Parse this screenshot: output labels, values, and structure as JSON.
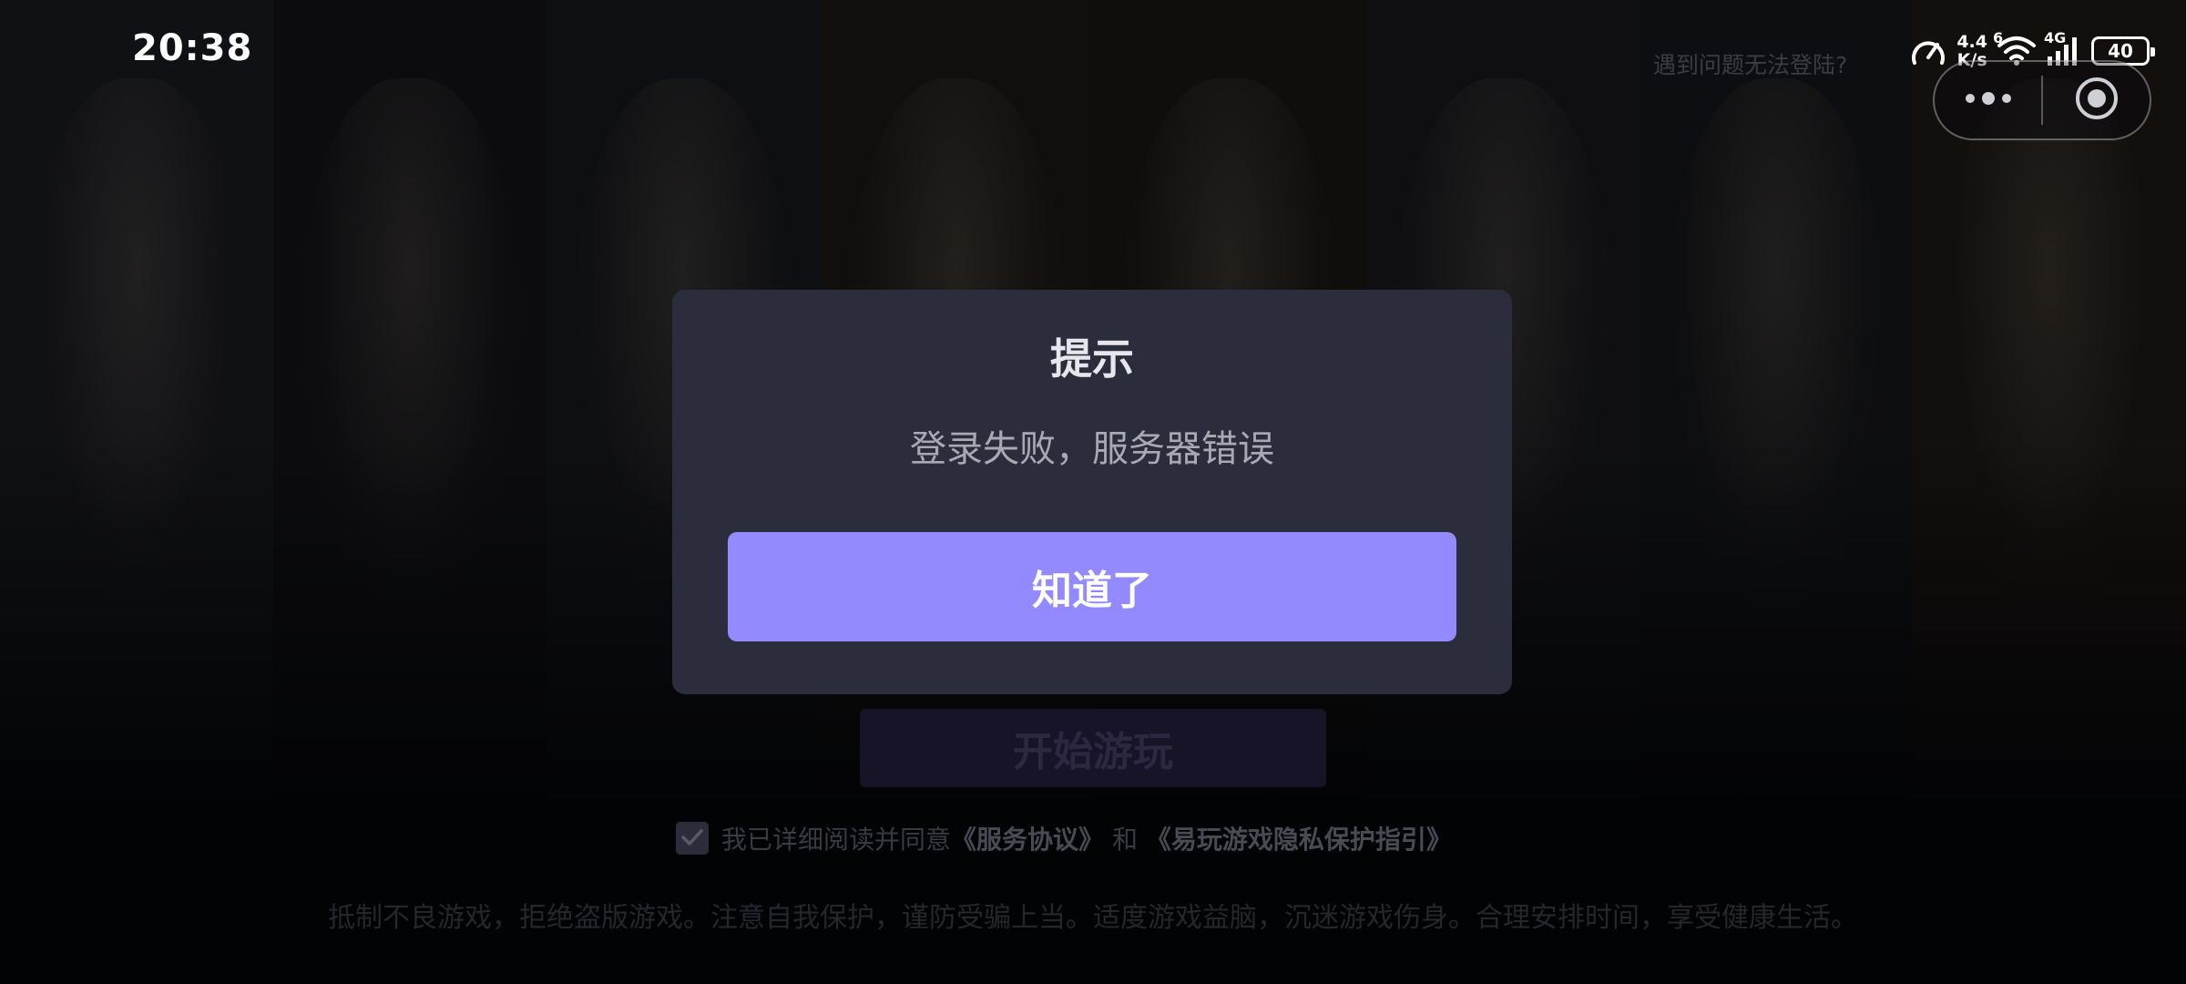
{
  "status_bar": {
    "time": "20:38",
    "net_speed_value": "4.4",
    "net_speed_unit": "K/s",
    "wifi_label": "6",
    "cell_label": "4G",
    "battery": "40"
  },
  "header": {
    "help_link": "遇到问题无法登陆?"
  },
  "dialog": {
    "title": "提示",
    "message": "登录失败，服务器错误",
    "confirm_label": "知道了"
  },
  "login": {
    "start_label": "开始游玩",
    "agree_prefix": "我已详细阅读并同意",
    "service_agreement": "《服务协议》",
    "agree_and": "和",
    "privacy_guide": "《易玩游戏隐私保护指引》",
    "agreement_checked": true
  },
  "footer": {
    "notice": "抵制不良游戏，拒绝盗版游戏。注意自我保护，谨防受骗上当。适度游戏益脑，沉迷游戏伤身。合理安排时间，享受健康生活。"
  },
  "icons": {
    "speed": "speedometer-icon",
    "wifi": "wifi-icon",
    "signal": "signal-bars-icon",
    "battery": "battery-icon",
    "more": "more-dots-icon",
    "close": "close-target-icon",
    "check": "checkmark-icon"
  },
  "colors": {
    "dialog_bg": "#2b2d3c",
    "accent": "#928afe",
    "title": "#e6e6ec",
    "message": "#a9a9b4"
  }
}
